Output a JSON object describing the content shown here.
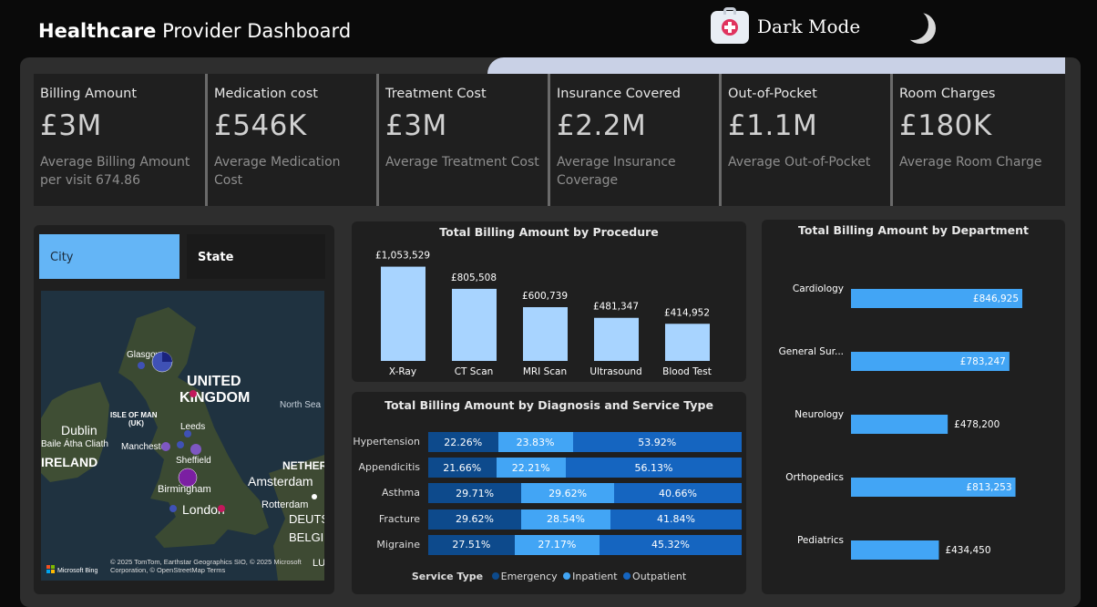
{
  "header": {
    "title_bold": "Healthcare",
    "title_rest": " Provider Dashboard",
    "mode_label": "Dark Mode"
  },
  "kpis": [
    {
      "title": "Billing Amount",
      "value": "£3M",
      "sub": "Average Billing Amount per visit 674.86"
    },
    {
      "title": "Medication cost",
      "value": "£546K",
      "sub": "Average Medication Cost"
    },
    {
      "title": "Treatment Cost",
      "value": "£3M",
      "sub": "Average Treatment Cost"
    },
    {
      "title": "Insurance Covered",
      "value": "£2.2M",
      "sub": "Average Insurance Coverage"
    },
    {
      "title": "Out-of-Pocket",
      "value": "£1.1M",
      "sub": "Average Out-of-Pocket"
    },
    {
      "title": "Room Charges",
      "value": "£180K",
      "sub": "Average Room Charge"
    }
  ],
  "slicer": {
    "city": "City",
    "state": "State"
  },
  "map": {
    "labels": [
      "Glasgow",
      "UNITED",
      "KINGDOM",
      "North Sea",
      "ISLE OF MAN",
      "(UK)",
      "Dublin",
      "Baile Átha Cliath",
      "IRELAND",
      "Leeds",
      "Manchester",
      "Sheffield",
      "Birmingham",
      "London",
      "NETHERL",
      "Amsterdam",
      "Rotterdam",
      "DEUTSC",
      "BELGIE",
      "LUX"
    ],
    "brand": "Microsoft Bing",
    "copyright": "© 2025 TomTom, Earthstar Geographics SIO, © 2025 Microsoft Corporation, © OpenStreetMap Terms"
  },
  "chart_data": [
    {
      "type": "bar",
      "title": "Total Billing Amount by Procedure",
      "categories": [
        "X-Ray",
        "CT Scan",
        "MRI Scan",
        "Ultrasound",
        "Blood Test"
      ],
      "values": [
        1053529,
        805508,
        600739,
        481347,
        414952
      ],
      "data_labels": [
        "£1,053,529",
        "£805,508",
        "£600,739",
        "£481,347",
        "£414,952"
      ],
      "color": "#a8d4ff"
    },
    {
      "type": "bar",
      "orientation": "horizontal",
      "title": "Total Billing Amount by Department",
      "categories": [
        "Cardiology",
        "General Sur...",
        "Neurology",
        "Orthopedics",
        "Pediatrics"
      ],
      "values": [
        846925,
        783247,
        478200,
        813253,
        434450
      ],
      "data_labels": [
        "£846,925",
        "£783,247",
        "£478,200",
        "£813,253",
        "£434,450"
      ],
      "color": "#42a5f5"
    },
    {
      "type": "bar",
      "stacked": "percent",
      "orientation": "horizontal",
      "title": "Total Billing Amount by Diagnosis and Service Type",
      "legend_title": "Service Type",
      "categories": [
        "Hypertension",
        "Appendicitis",
        "Asthma",
        "Fracture",
        "Migraine"
      ],
      "series": [
        {
          "name": "Emergency",
          "values": [
            22.26,
            21.66,
            29.71,
            29.62,
            27.51
          ],
          "labels": [
            "22.26%",
            "21.66%",
            "29.71%",
            "29.62%",
            "27.51%"
          ],
          "color": "#0d4a8c"
        },
        {
          "name": "Inpatient",
          "values": [
            23.83,
            22.21,
            29.62,
            28.54,
            27.17
          ],
          "labels": [
            "23.83%",
            "22.21%",
            "29.62%",
            "28.54%",
            "27.17%"
          ],
          "color": "#42a5f5"
        },
        {
          "name": "Outpatient",
          "values": [
            53.92,
            56.13,
            40.66,
            41.84,
            45.32
          ],
          "labels": [
            "53.92%",
            "56.13%",
            "40.66%",
            "41.84%",
            "45.32%"
          ],
          "color": "#1565c0"
        }
      ]
    }
  ]
}
